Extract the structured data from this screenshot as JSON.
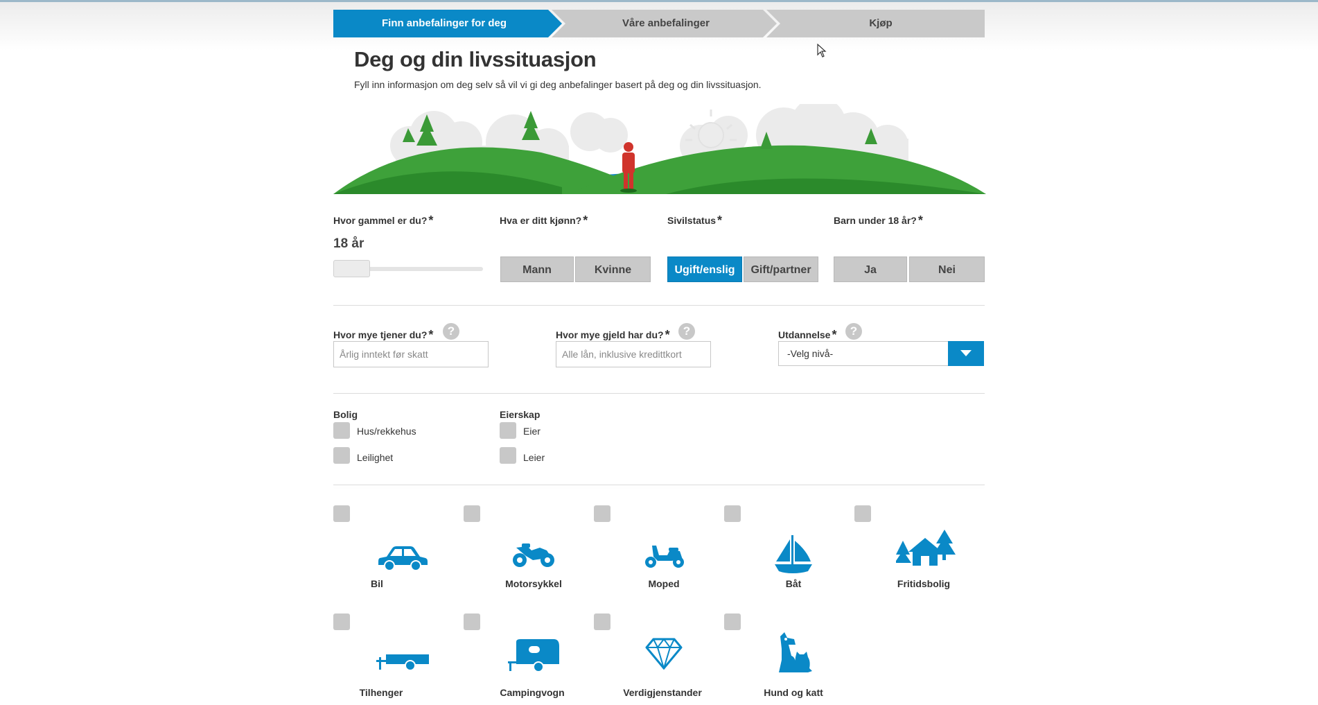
{
  "colors": {
    "accent": "#0a89c7",
    "step_inactive": "#c9c9c9",
    "checkbox": "#c8c8c8"
  },
  "stepper": {
    "steps": [
      {
        "label": "Finn anbefalinger for deg",
        "active": true
      },
      {
        "label": "Våre anbefalinger",
        "active": false
      },
      {
        "label": "Kjøp",
        "active": false
      }
    ]
  },
  "header": {
    "title": "Deg og din livssituasjon",
    "subtitle": "Fyll inn informasjon om deg selv så vil vi gi deg anbefalinger basert på deg og din livssituasjon."
  },
  "required_mark": "*",
  "age": {
    "label": "Hvor gammel er du?",
    "value": "18 år"
  },
  "gender": {
    "label": "Hva er ditt kjønn?",
    "options": [
      "Mann",
      "Kvinne"
    ],
    "selected": null
  },
  "civil": {
    "label": "Sivilstatus",
    "options": [
      "Ugift/enslig",
      "Gift/partner"
    ],
    "selected": "Ugift/enslig"
  },
  "children": {
    "label": "Barn under 18 år?",
    "options": [
      "Ja",
      "Nei"
    ],
    "selected": null
  },
  "income": {
    "label": "Hvor mye tjener du?",
    "placeholder": "Årlig inntekt før skatt",
    "help": "?"
  },
  "debt": {
    "label": "Hvor mye gjeld har du?",
    "placeholder": "Alle lån, inklusive kredittkort",
    "help": "?"
  },
  "education": {
    "label": "Utdannelse",
    "value": "-Velg nivå-",
    "help": "?"
  },
  "housing": {
    "label": "Bolig",
    "options": [
      "Hus/rekkehus",
      "Leilighet"
    ]
  },
  "ownership": {
    "label": "Eierskap",
    "options": [
      "Eier",
      "Leier"
    ]
  },
  "possessions": [
    {
      "label": "Bil",
      "icon": "car-icon"
    },
    {
      "label": "Motorsykkel",
      "icon": "motorcycle-icon"
    },
    {
      "label": "Moped",
      "icon": "moped-icon"
    },
    {
      "label": "Båt",
      "icon": "sailboat-icon"
    },
    {
      "label": "Fritidsbolig",
      "icon": "cabin-icon"
    },
    {
      "label": "Tilhenger",
      "icon": "trailer-icon"
    },
    {
      "label": "Campingvogn",
      "icon": "caravan-icon"
    },
    {
      "label": "Verdigjenstander",
      "icon": "diamond-icon"
    },
    {
      "label": "Hund og katt",
      "icon": "dog-and-cat-icon"
    }
  ]
}
